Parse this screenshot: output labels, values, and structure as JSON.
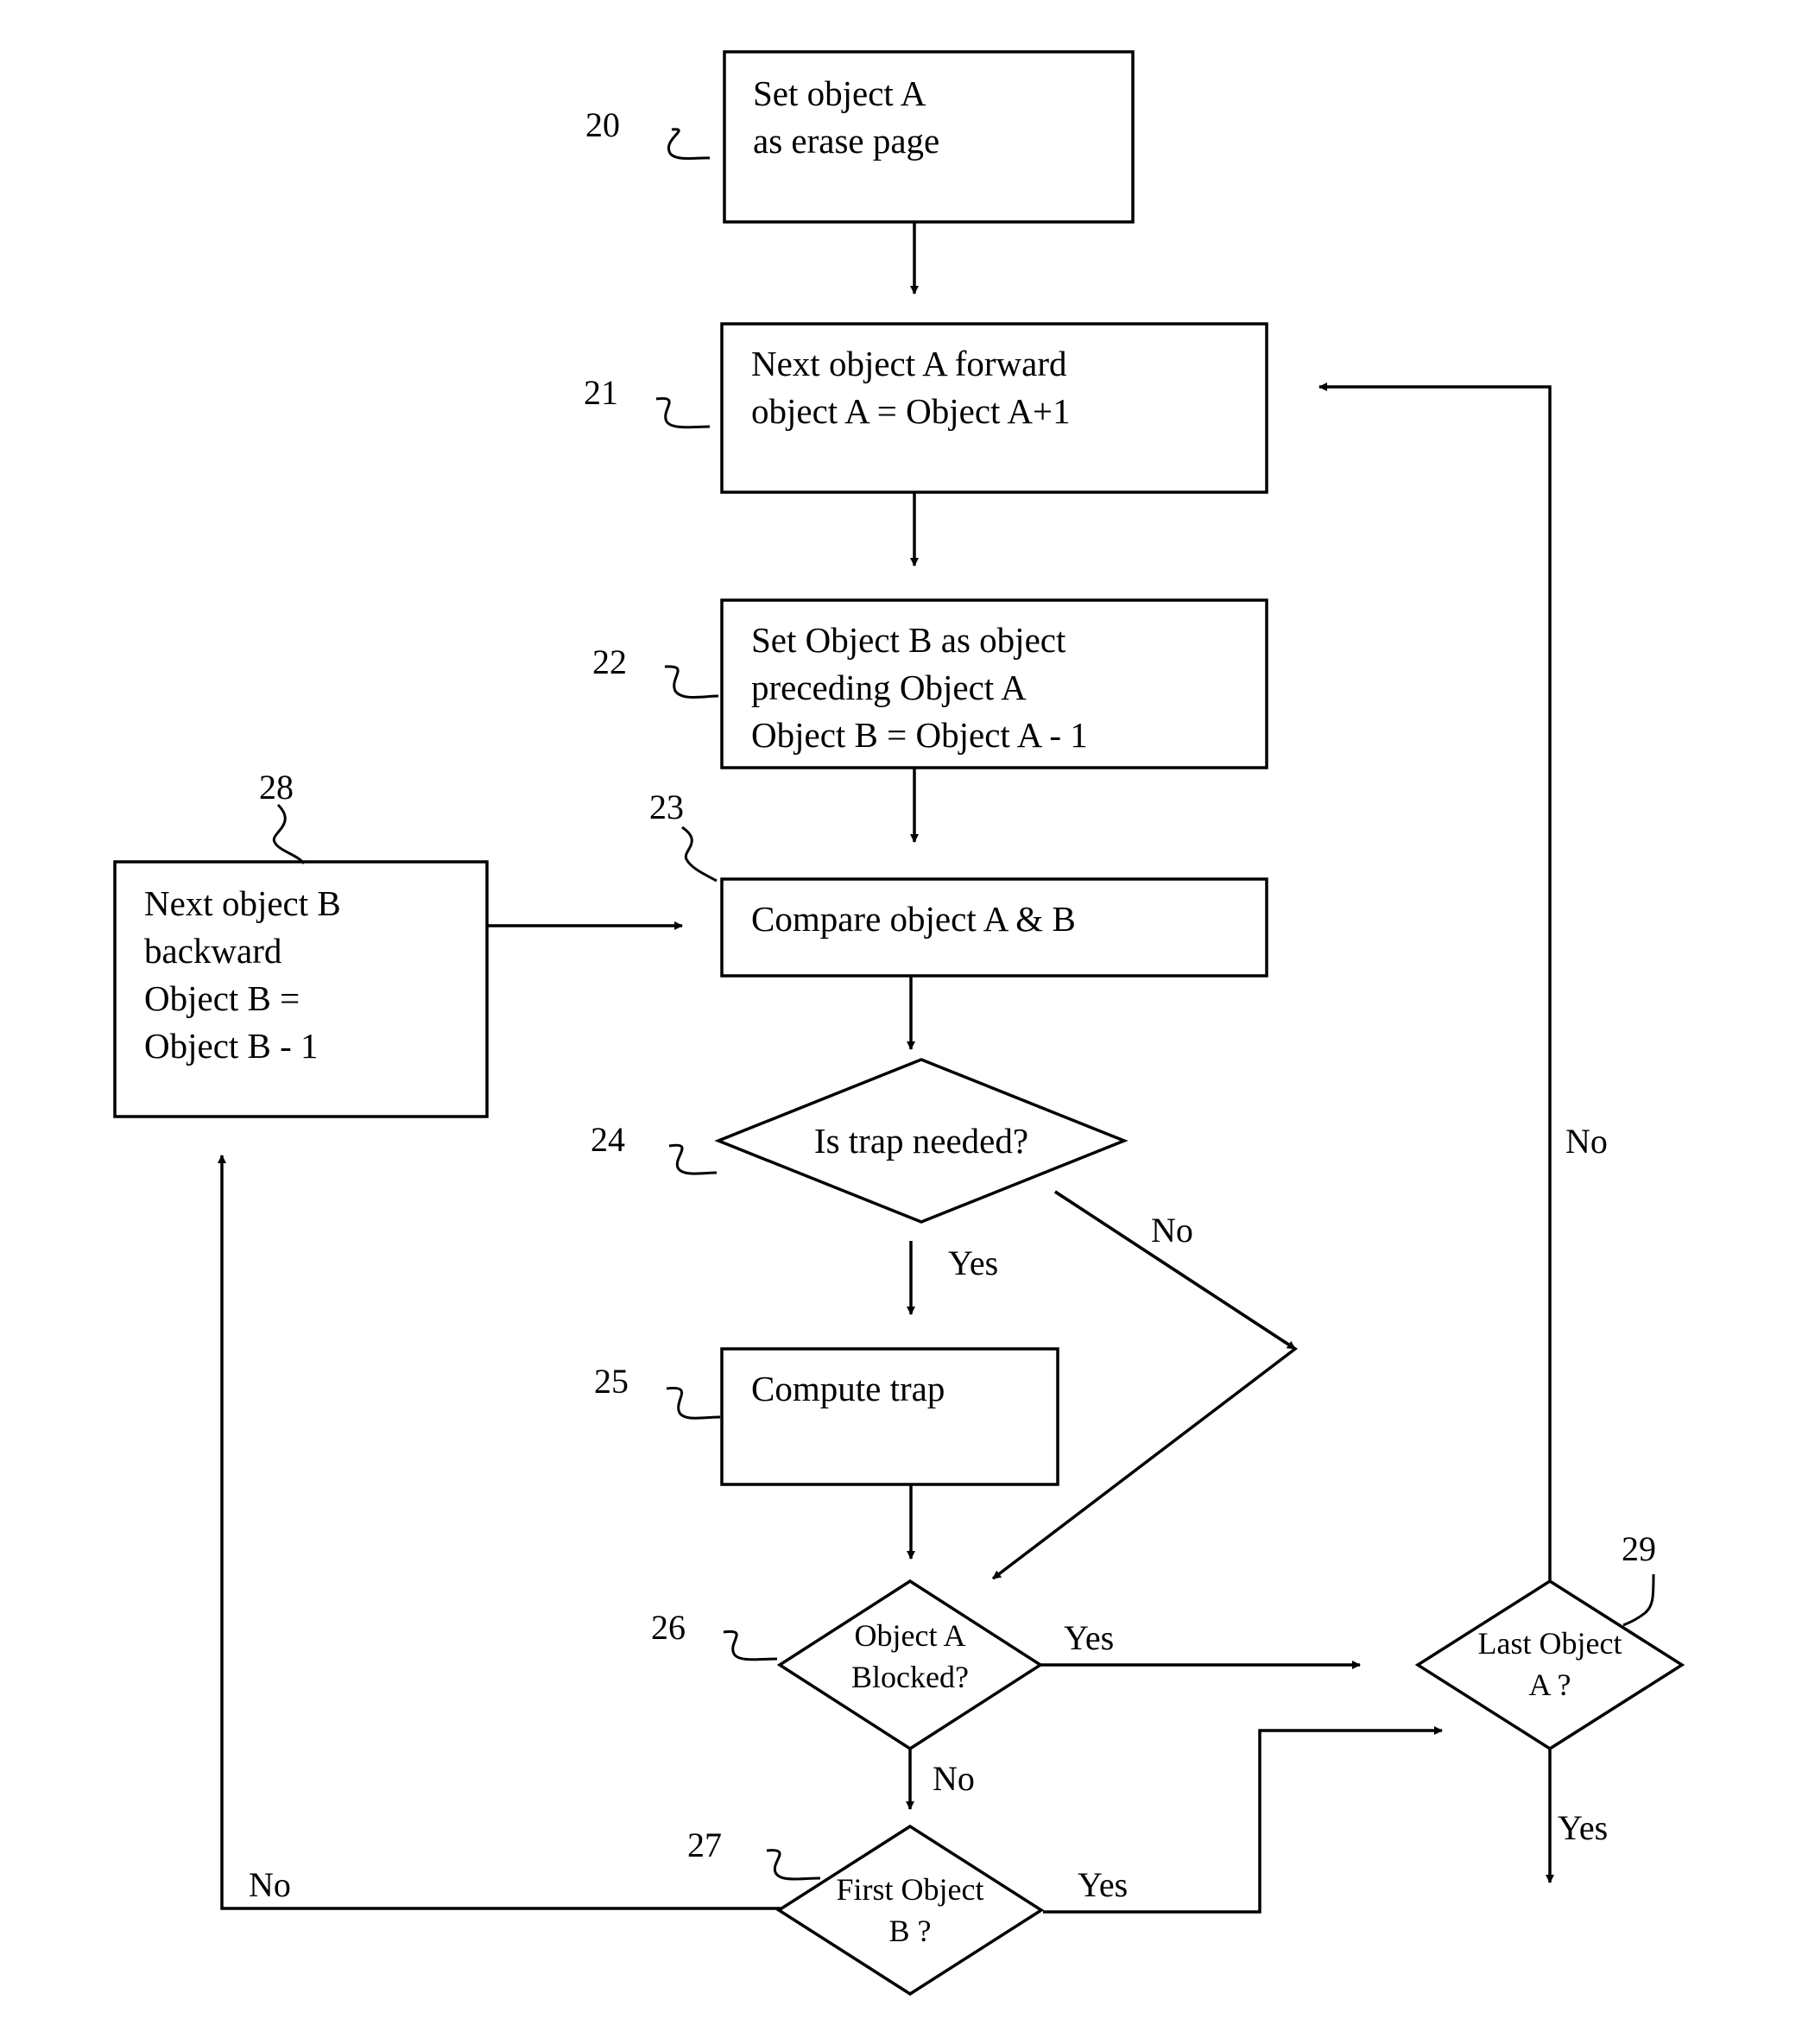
{
  "diagram": {
    "type": "flowchart",
    "nodes": [
      {
        "id": "20",
        "shape": "process",
        "lines": [
          "Set object A",
          "as erase page"
        ]
      },
      {
        "id": "21",
        "shape": "process",
        "lines": [
          "Next object A forward",
          "object A = Object A+1"
        ]
      },
      {
        "id": "22",
        "shape": "process",
        "lines": [
          "Set Object B as object",
          "preceding Object A",
          "Object B = Object A - 1"
        ]
      },
      {
        "id": "23",
        "shape": "process",
        "lines": [
          "Compare object A & B"
        ]
      },
      {
        "id": "24",
        "shape": "decision",
        "lines": [
          "Is trap needed?"
        ]
      },
      {
        "id": "25",
        "shape": "process",
        "lines": [
          "Compute trap"
        ]
      },
      {
        "id": "26",
        "shape": "decision",
        "lines": [
          "Object A",
          "Blocked?"
        ]
      },
      {
        "id": "27",
        "shape": "decision",
        "lines": [
          "First Object",
          "B ?"
        ]
      },
      {
        "id": "28",
        "shape": "process",
        "lines": [
          "Next object B",
          "backward",
          "Object B =",
          "Object B - 1"
        ]
      },
      {
        "id": "29",
        "shape": "decision",
        "lines": [
          "Last Object",
          "A ?"
        ]
      }
    ],
    "edges": [
      {
        "from": "20",
        "to": "21",
        "label": ""
      },
      {
        "from": "21",
        "to": "22",
        "label": ""
      },
      {
        "from": "22",
        "to": "23",
        "label": ""
      },
      {
        "from": "28",
        "to": "23",
        "label": ""
      },
      {
        "from": "23",
        "to": "24",
        "label": ""
      },
      {
        "from": "24",
        "to": "25",
        "label": "Yes"
      },
      {
        "from": "24",
        "to": "26",
        "label": "No"
      },
      {
        "from": "25",
        "to": "26",
        "label": ""
      },
      {
        "from": "26",
        "to": "29",
        "label": "Yes"
      },
      {
        "from": "26",
        "to": "27",
        "label": "No"
      },
      {
        "from": "27",
        "to": "29",
        "label": "Yes"
      },
      {
        "from": "27",
        "to": "28",
        "label": "No"
      },
      {
        "from": "29",
        "to": "21",
        "label": "No"
      },
      {
        "from": "29",
        "to": "end",
        "label": "Yes"
      }
    ],
    "labels": {
      "yes": "Yes",
      "no": "No"
    }
  }
}
